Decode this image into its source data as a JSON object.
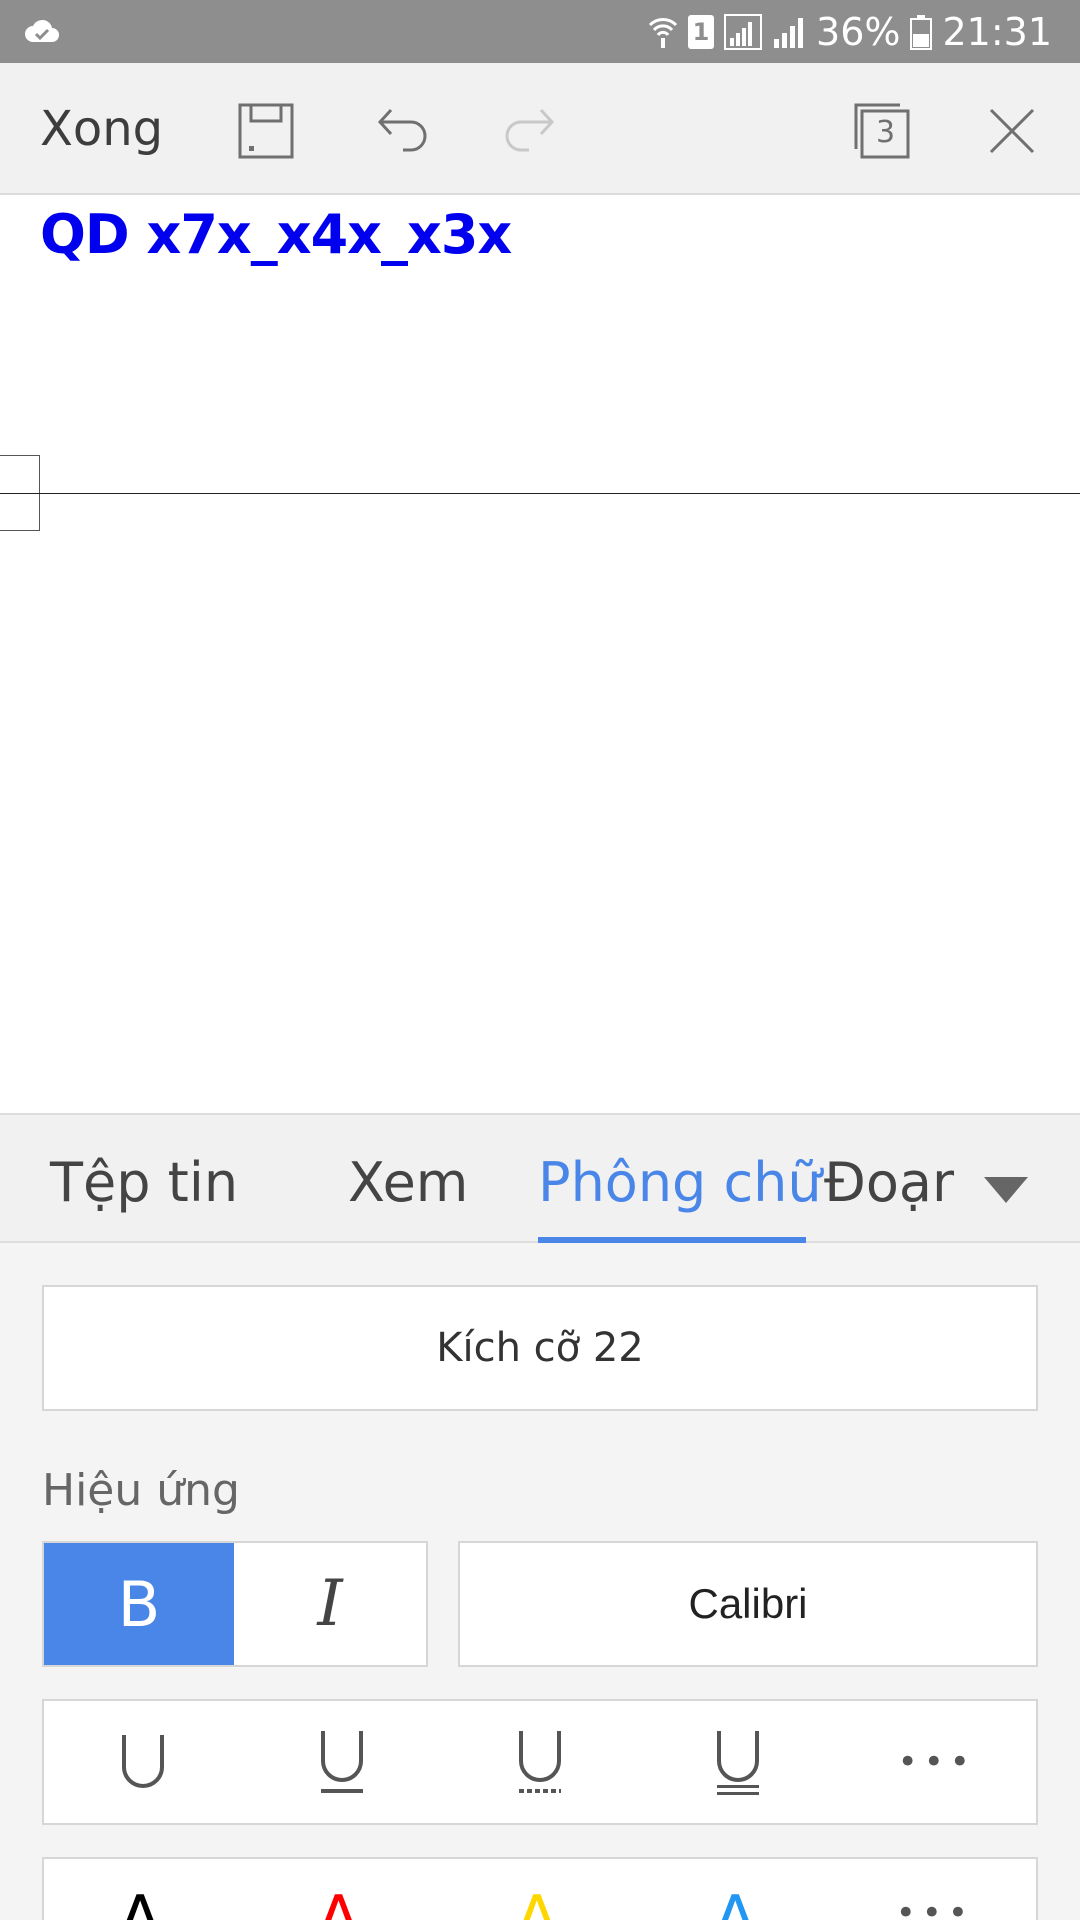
{
  "status_bar": {
    "battery_percent": "36%",
    "time": "21:31",
    "sim_slot": "1"
  },
  "toolbar": {
    "done_label": "Xong",
    "window_count": "3"
  },
  "document": {
    "title_text": "QD x7x_x4x_x3x",
    "title_color": "#0000ee"
  },
  "ribbon": {
    "tabs": [
      {
        "label": "Tệp tin",
        "active": false
      },
      {
        "label": "Xem",
        "active": false
      },
      {
        "label": "Phông chữ",
        "active": true
      },
      {
        "label": "Đoạn",
        "active": false
      }
    ],
    "accent_color": "#4a86e8"
  },
  "panel": {
    "size_label": "Kích cỡ  22",
    "effects_label": "Hiệu ứng",
    "bold_label": "B",
    "italic_label": "I",
    "font_name": "Calibri",
    "underline_styles": [
      "single",
      "single-thick",
      "dotted",
      "double"
    ],
    "more_label": "•••",
    "font_colors": [
      "#000000",
      "#ff0000",
      "#ffd700",
      "#2196f3"
    ]
  }
}
